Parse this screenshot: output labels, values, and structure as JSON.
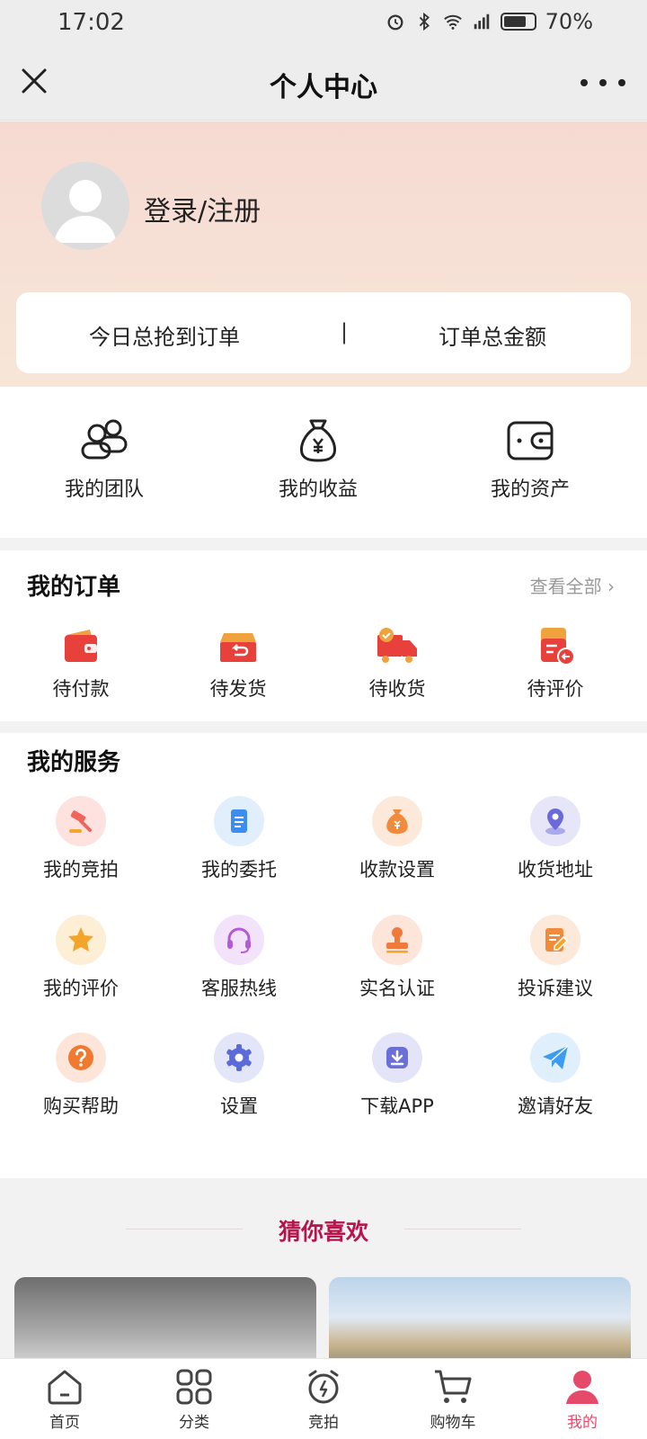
{
  "status_bar": {
    "time": "17:02",
    "battery": "70%"
  },
  "nav": {
    "title": "个人中心"
  },
  "profile": {
    "login_label": "登录/注册"
  },
  "stats": {
    "today_orders_label": "今日总抢到订单",
    "divider": "|",
    "total_amount_label": "订单总金额"
  },
  "quick_links": [
    {
      "label": "我的团队",
      "icon": "team-icon"
    },
    {
      "label": "我的收益",
      "icon": "money-bag-icon"
    },
    {
      "label": "我的资产",
      "icon": "wallet-icon"
    }
  ],
  "orders": {
    "title": "我的订单",
    "view_all": "查看全部",
    "items": [
      {
        "label": "待付款",
        "icon": "wallet-red-icon"
      },
      {
        "label": "待发货",
        "icon": "box-icon"
      },
      {
        "label": "待收货",
        "icon": "truck-icon"
      },
      {
        "label": "待评价",
        "icon": "review-doc-icon"
      }
    ]
  },
  "services": {
    "title": "我的服务",
    "items": [
      {
        "label": "我的竞拍",
        "icon": "auction-hammer-icon",
        "color": "#f0645a"
      },
      {
        "label": "我的委托",
        "icon": "document-icon",
        "color": "#3d8cf0"
      },
      {
        "label": "收款设置",
        "icon": "money-bag-icon",
        "color": "#f08a3c"
      },
      {
        "label": "收货地址",
        "icon": "location-pin-icon",
        "color": "#6a6ad8"
      },
      {
        "label": "我的评价",
        "icon": "star-icon",
        "color": "#f3a52b"
      },
      {
        "label": "客服热线",
        "icon": "headset-icon",
        "color": "#b45ad8"
      },
      {
        "label": "实名认证",
        "icon": "stamp-icon",
        "color": "#f07a3c"
      },
      {
        "label": "投诉建议",
        "icon": "edit-note-icon",
        "color": "#f08a3c"
      },
      {
        "label": "购买帮助",
        "icon": "question-icon",
        "color": "#f07a30"
      },
      {
        "label": "设置",
        "icon": "gear-icon",
        "color": "#5b6cd8"
      },
      {
        "label": "下载APP",
        "icon": "download-icon",
        "color": "#6a70d8"
      },
      {
        "label": "邀请好友",
        "icon": "paper-plane-icon",
        "color": "#3d9cf0"
      }
    ]
  },
  "recommend": {
    "title": "猜你喜欢"
  },
  "tabs": [
    {
      "label": "首页",
      "icon": "home-icon"
    },
    {
      "label": "分类",
      "icon": "category-icon"
    },
    {
      "label": "竞拍",
      "icon": "auction-clock-icon"
    },
    {
      "label": "购物车",
      "icon": "cart-icon"
    },
    {
      "label": "我的",
      "icon": "user-icon",
      "active": true,
      "color": "#e64a6b"
    }
  ]
}
